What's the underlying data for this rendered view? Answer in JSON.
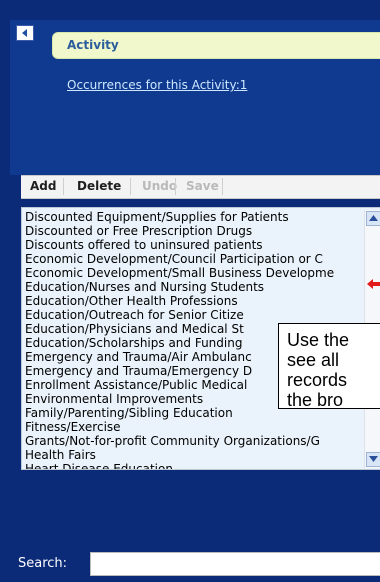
{
  "activity": {
    "title": "Activity",
    "occurrences_link": "Occurrences for this Activity:1"
  },
  "toolbar": {
    "add": "Add",
    "delete": "Delete",
    "undo": "Undo",
    "save": "Save"
  },
  "list_items": [
    "Discounted Equipment/Supplies for Patients",
    "Discounted or Free Prescription Drugs",
    "Discounts offered to uninsured patients",
    "Economic Development/Council Participation or C",
    "Economic Development/Small Business Developme",
    "Education/Nurses and Nursing Students",
    "Education/Other Health Professions",
    "Education/Outreach for Senior Citize",
    "Education/Physicians and Medical St",
    "Education/Scholarships and Funding",
    "Emergency and Trauma/Air Ambulanc",
    "Emergency and Trauma/Emergency D",
    "Enrollment Assistance/Public Medical",
    "Environmental Improvements",
    "Family/Parenting/Sibling Education",
    "Fitness/Exercise",
    "Grants/Not-for-profit Community Organizations/G",
    "Health Fairs",
    "Heart Disease Education"
  ],
  "tooltip": {
    "lines": [
      "Use the",
      "see all",
      "records",
      "the bro"
    ]
  },
  "search": {
    "label": "Search:",
    "value": ""
  },
  "icons": {
    "collapse": "collapse-arrow-icon",
    "scroll_up": "scroll-up-icon",
    "scroll_down": "scroll-down-icon",
    "callout_arrow": "red-arrow-icon"
  },
  "colors": {
    "panel_bg": "#0b2a78",
    "header_bg": "#f0f8cc",
    "list_bg": "#eaf3fb",
    "callout_red": "#e21b1b"
  }
}
